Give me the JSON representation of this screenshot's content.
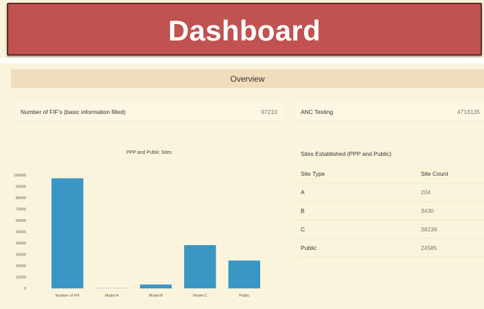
{
  "header": {
    "title": "Dashboard"
  },
  "overview": {
    "title": "Overview"
  },
  "stats": [
    {
      "label": "Number of FIF's (basic information filled)",
      "value": "97210"
    },
    {
      "label": "ANC Testing",
      "value": "4718135"
    }
  ],
  "sites_table": {
    "title": "Sites Established (PPP and Public)",
    "headers": [
      "Site Type",
      "Site Count"
    ],
    "rows": [
      {
        "type": "A",
        "count": "204"
      },
      {
        "type": "B",
        "count": "3430"
      },
      {
        "type": "C",
        "count": "38238"
      },
      {
        "type": "Public",
        "count": "24585"
      }
    ]
  },
  "chart_data": {
    "type": "bar",
    "title": "PPP and Public Sites",
    "categories": [
      "Number of FIF",
      "Model A",
      "Model B",
      "Model C",
      "Public"
    ],
    "values": [
      97210,
      204,
      3430,
      38238,
      24585
    ],
    "ylim": [
      0,
      100000
    ],
    "yticks": [
      0,
      10000,
      20000,
      30000,
      40000,
      50000,
      60000,
      70000,
      80000,
      90000,
      100000
    ],
    "xlabel": "",
    "ylabel": "",
    "bar_color": "#3a96c4",
    "grid": false
  },
  "colors": {
    "header_bg": "#c0524f",
    "page_bg": "#fbf4dd",
    "overview_bg": "#f1dcbb"
  }
}
